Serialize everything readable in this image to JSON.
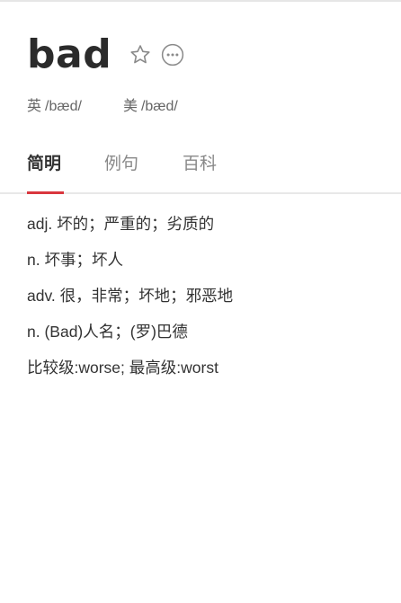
{
  "header": {
    "word": "bad",
    "favorite_icon": "star-outline-icon",
    "more_icon": "more-dots-icon"
  },
  "phonetics": [
    {
      "label": "英",
      "ipa": "/bæd/"
    },
    {
      "label": "美",
      "ipa": "/bæd/"
    }
  ],
  "tabs": [
    {
      "label": "简明",
      "active": true
    },
    {
      "label": "例句",
      "active": false
    },
    {
      "label": "百科",
      "active": false
    }
  ],
  "definitions": [
    "adj. 坏的；严重的；劣质的",
    "n. 坏事；坏人",
    "adv. 很，非常；坏地；邪恶地",
    "n. (Bad)人名；(罗)巴德",
    "比较级:worse; 最高级:worst"
  ],
  "colors": {
    "accent": "#d9363e",
    "text": "#333333",
    "muted": "#888888"
  }
}
